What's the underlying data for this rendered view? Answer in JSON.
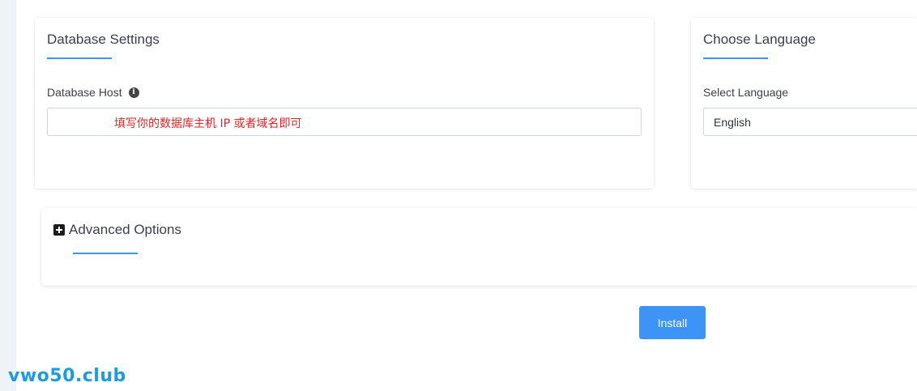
{
  "database_settings": {
    "title": "Database Settings",
    "host_label": "Database Host",
    "host_value": "",
    "host_annotation": "填写你的数据库主机 IP 或者域名即可"
  },
  "language": {
    "title": "Choose Language",
    "select_label": "Select Language",
    "selected": "English"
  },
  "advanced": {
    "title": "Advanced Options"
  },
  "actions": {
    "install_label": "Install"
  },
  "watermark": "vwo50.club",
  "colors": {
    "accent": "#3d94f6",
    "annotation": "#e0242a",
    "watermark": "#1e9be0"
  }
}
